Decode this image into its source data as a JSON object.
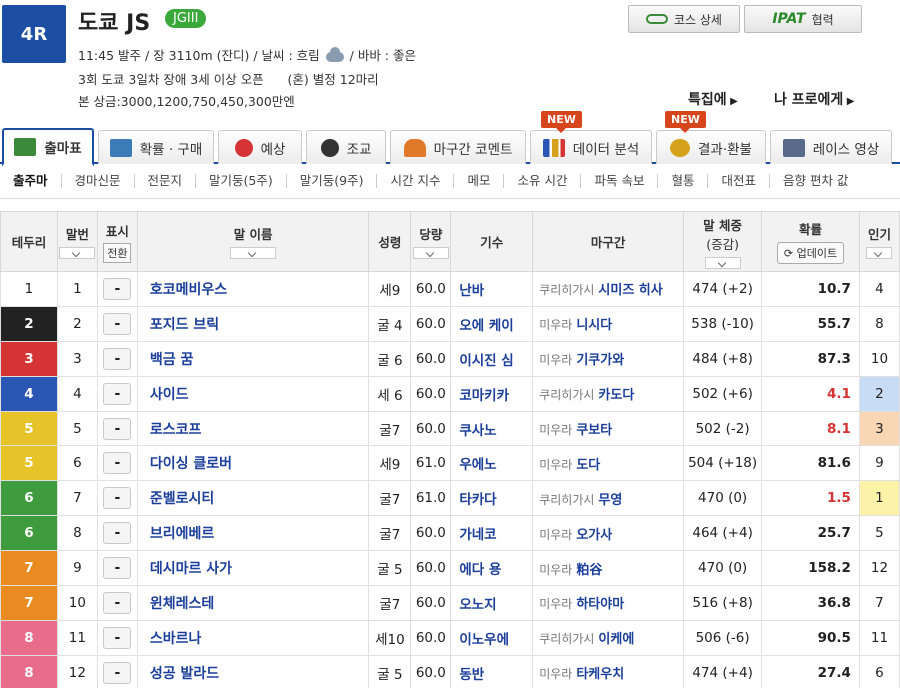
{
  "race": {
    "number": "4R",
    "name": "도쿄 JS",
    "grade": "JGIII",
    "line1_pre": "11:45 발주 / 장 3110m (잔디) / 날씨 : 흐림",
    "line1_post": "/ 바바 : 좋은",
    "line2": "3회 도쿄 3일차 장애 3세 이상 오픈      (혼) 별정 12마리",
    "line3": "본 상금:3000,1200,750,450,300만엔"
  },
  "header_buttons": {
    "course": "코스 상세",
    "ipat_logo": "IPAT",
    "ipat_label": "협력"
  },
  "links": {
    "special": "특집에",
    "pro": "나 프로에게"
  },
  "tabs": [
    {
      "label": "출마표",
      "icon": "race-card-icon",
      "color": "#3a8a3a"
    },
    {
      "label": "확률 · 구매",
      "icon": "odds-icon",
      "color": "#3a7bb8"
    },
    {
      "label": "예상",
      "icon": "target-icon",
      "color": "#d63434"
    },
    {
      "label": "조교",
      "icon": "stopwatch-icon",
      "color": "#333333"
    },
    {
      "label": "마구간 코멘트",
      "icon": "stable-icon",
      "color": "#e07a2a"
    },
    {
      "label": "데이터 분석",
      "icon": "bar-chart-icon",
      "color": "#d6a21b",
      "badge": "NEW"
    },
    {
      "label": "결과·환불",
      "icon": "coins-icon",
      "color": "#d6a21b",
      "badge": "NEW"
    },
    {
      "label": "레이스 영상",
      "icon": "video-icon",
      "color": "#5a6a8a"
    }
  ],
  "subtabs": [
    "출주마",
    "경마신문",
    "전문지",
    "말기둥(5주)",
    "말기둥(9주)",
    "시간 지수",
    "메모",
    "소유 시간",
    "파독 속보",
    "혈통",
    "대전표",
    "음향 편차 값"
  ],
  "columns": {
    "gate": "테두리",
    "num": "말번",
    "mark": "표시",
    "mark_toggle": "전환",
    "name": "말 이름",
    "sexage": "성령",
    "weight": "당량",
    "jockey": "기수",
    "trainer": "마구간",
    "bodyweight": "말 체중",
    "bodyweight_sub": "(증감)",
    "odds": "확률",
    "odds_update": "업데이트",
    "pop": "인기"
  },
  "rows": [
    {
      "gate": "1",
      "num": "1",
      "mark": "-",
      "name": "호코메비우스",
      "sexage": "세9",
      "weight": "60.0",
      "jockey": "난바",
      "trainer_area": "쿠리히가시",
      "trainer": "시미즈 히사",
      "bw": "474 (+2)",
      "odds": "10.7",
      "pop": "4"
    },
    {
      "gate": "2",
      "num": "2",
      "mark": "-",
      "name": "포지드 브릭",
      "sexage": "굴 4",
      "weight": "60.0",
      "jockey": "오에 케이",
      "trainer_area": "미우라",
      "trainer": "니시다",
      "bw": "538 (-10)",
      "odds": "55.7",
      "pop": "8"
    },
    {
      "gate": "3",
      "num": "3",
      "mark": "-",
      "name": "백금 꿈",
      "sexage": "굴 6",
      "weight": "60.0",
      "jockey": "이시진 심",
      "trainer_area": "미우라",
      "trainer": "기쿠가와",
      "bw": "484 (+8)",
      "odds": "87.3",
      "pop": "10"
    },
    {
      "gate": "4",
      "num": "4",
      "mark": "-",
      "name": "사이드",
      "sexage": "세 6",
      "weight": "60.0",
      "jockey": "코마키카",
      "trainer_area": "쿠리히가시",
      "trainer": "카도다",
      "bw": "502 (+6)",
      "odds": "4.1",
      "pop": "2"
    },
    {
      "gate": "5",
      "num": "5",
      "mark": "-",
      "name": "로스코프",
      "sexage": "굴7",
      "weight": "60.0",
      "jockey": "쿠사노",
      "trainer_area": "미우라",
      "trainer": "쿠보타",
      "bw": "502 (-2)",
      "odds": "8.1",
      "pop": "3"
    },
    {
      "gate": "5",
      "num": "6",
      "mark": "-",
      "name": "다이싱 클로버",
      "sexage": "세9",
      "weight": "61.0",
      "jockey": "우에노",
      "trainer_area": "미우라",
      "trainer": "도다",
      "bw": "504 (+18)",
      "odds": "81.6",
      "pop": "9"
    },
    {
      "gate": "6",
      "num": "7",
      "mark": "-",
      "name": "준벨로시티",
      "sexage": "굴7",
      "weight": "61.0",
      "jockey": "타카다",
      "trainer_area": "쿠리히가시",
      "trainer": "무영",
      "bw": "470 (0)",
      "odds": "1.5",
      "pop": "1"
    },
    {
      "gate": "6",
      "num": "8",
      "mark": "-",
      "name": "브리에베르",
      "sexage": "굴7",
      "weight": "60.0",
      "jockey": "가네코",
      "trainer_area": "미우라",
      "trainer": "오가사",
      "bw": "464 (+4)",
      "odds": "25.7",
      "pop": "5"
    },
    {
      "gate": "7",
      "num": "9",
      "mark": "-",
      "name": "데시마르 사가",
      "sexage": "굴 5",
      "weight": "60.0",
      "jockey": "에다 용",
      "trainer_area": "미우라",
      "trainer": "粕谷",
      "bw": "470 (0)",
      "odds": "158.2",
      "pop": "12"
    },
    {
      "gate": "7",
      "num": "10",
      "mark": "-",
      "name": "윈체레스테",
      "sexage": "굴7",
      "weight": "60.0",
      "jockey": "오노지",
      "trainer_area": "미우라",
      "trainer": "하타야마",
      "bw": "516 (+8)",
      "odds": "36.8",
      "pop": "7"
    },
    {
      "gate": "8",
      "num": "11",
      "mark": "-",
      "name": "스바르나",
      "sexage": "세10",
      "weight": "60.0",
      "jockey": "이노우에",
      "trainer_area": "쿠리히가시",
      "trainer": "이케에",
      "bw": "506 (-6)",
      "odds": "90.5",
      "pop": "11"
    },
    {
      "gate": "8",
      "num": "12",
      "mark": "-",
      "name": "성공 발라드",
      "sexage": "굴 5",
      "weight": "60.0",
      "jockey": "동반",
      "trainer_area": "미우라",
      "trainer": "타케우치",
      "bw": "474 (+4)",
      "odds": "27.4",
      "pop": "6"
    }
  ],
  "colors": {
    "accent": "#1c4fa3",
    "grade": "#3aa83a",
    "hot_odds": "#d63434",
    "gate_1": "#ffffff",
    "gate_2": "#222222",
    "gate_3": "#d63434",
    "gate_4": "#2c56b3",
    "gate_5": "#e6c328",
    "gate_6": "#3e9b3e",
    "gate_7": "#ea8b22",
    "gate_8": "#e86d8a"
  }
}
